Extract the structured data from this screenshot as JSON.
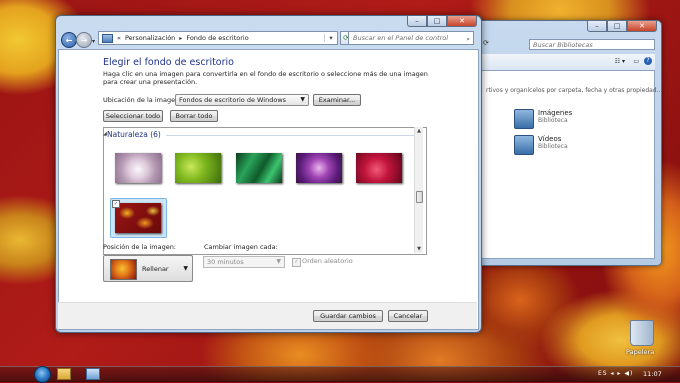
{
  "desktop": {
    "recycle_bin_label": "Papelera",
    "clock": "11:07",
    "tray_text": "ES ◂ ▸ ◀)"
  },
  "libraries_window": {
    "search_placeholder": "Buscar Bibliotecas",
    "description": "rtivos y organícelos por carpeta, fecha y otras propiedad...",
    "items": [
      {
        "name": "Imágenes",
        "type": "Biblioteca",
        "icon": "pictures-library-icon"
      },
      {
        "name": "Vídeos",
        "type": "Biblioteca",
        "icon": "videos-library-icon"
      }
    ],
    "caption_min": "–",
    "caption_max": "□",
    "caption_close": "✕"
  },
  "main_window": {
    "breadcrumb": {
      "prefix": "«",
      "items": [
        "Personalización",
        "Fondo de escritorio"
      ]
    },
    "search_placeholder": "Buscar en el Panel de control",
    "caption_min": "–",
    "caption_max": "□",
    "caption_close": "✕",
    "heading": "Elegir el fondo de escritorio",
    "description": "Haga clic en una imagen para convertirla en el fondo de escritorio o seleccione más de una imagen para crear una presentación.",
    "location": {
      "label": "Ubicación de la imagen:",
      "value": "Fondos de escritorio de Windows",
      "browse_button": "Examinar..."
    },
    "select_all_button": "Seleccionar todo",
    "clear_all_button": "Borrar todo",
    "gallery": {
      "group_label": "Naturaleza (6)",
      "thumbnails": [
        "white-flower",
        "green-leaves",
        "green-fronds",
        "purple-thistle",
        "red-flower",
        "autumn-leaves"
      ],
      "selected_index": 5
    },
    "position": {
      "label": "Posición de la imagen:",
      "value": "Rellenar"
    },
    "change_interval": {
      "label": "Cambiar imagen cada:",
      "value": "30 minutos"
    },
    "shuffle_label": "Orden aleatorio",
    "save_button": "Guardar cambios",
    "cancel_button": "Cancelar"
  },
  "colors": {
    "heading": "#1e3287",
    "window_frame": "#c9dbef",
    "wallpaper_base": "#9a1414"
  }
}
